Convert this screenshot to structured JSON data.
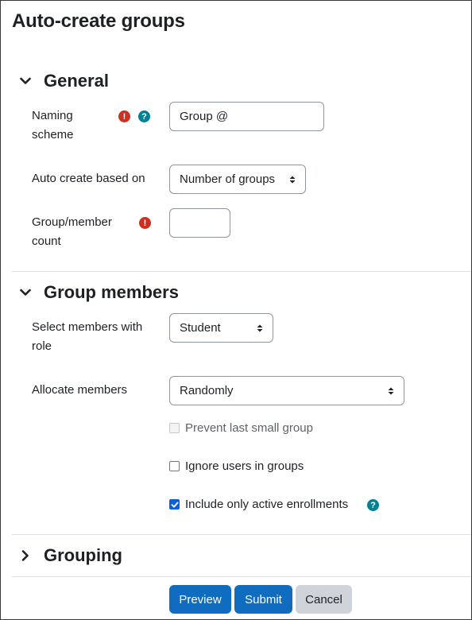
{
  "page": {
    "title": "Auto-create groups"
  },
  "sections": {
    "general": {
      "title": "General"
    },
    "group_members": {
      "title": "Group members"
    },
    "grouping": {
      "title": "Grouping"
    }
  },
  "fields": {
    "naming_scheme": {
      "label_line1": "Naming",
      "label_line2": "scheme",
      "value": "Group @",
      "required_icon": "exclamation-circle-icon",
      "help_icon": "question-circle-icon"
    },
    "auto_create_based_on": {
      "label": "Auto create based on",
      "value": "Number of groups"
    },
    "group_member_count": {
      "label_line1": "Group/member",
      "label_line2": "count",
      "value": "",
      "required_icon": "exclamation-circle-icon"
    },
    "select_members_with_role": {
      "label_line1": "Select members with",
      "label_line2": "role",
      "value": "Student"
    },
    "allocate_members": {
      "label": "Allocate members",
      "value": "Randomly"
    }
  },
  "checkboxes": {
    "prevent_last_small_group": {
      "label": "Prevent last small group",
      "checked": false,
      "disabled": true
    },
    "ignore_users_in_groups": {
      "label": "Ignore users in groups",
      "checked": false
    },
    "include_only_active": {
      "label": "Include only active enrollments",
      "checked": true,
      "help_icon": "question-circle-icon"
    }
  },
  "buttons": {
    "preview": "Preview",
    "submit": "Submit",
    "cancel": "Cancel"
  },
  "colors": {
    "primary": "#0f6cbf",
    "required": "#ca3120",
    "help": "#008196",
    "secondary": "#ced4da"
  }
}
